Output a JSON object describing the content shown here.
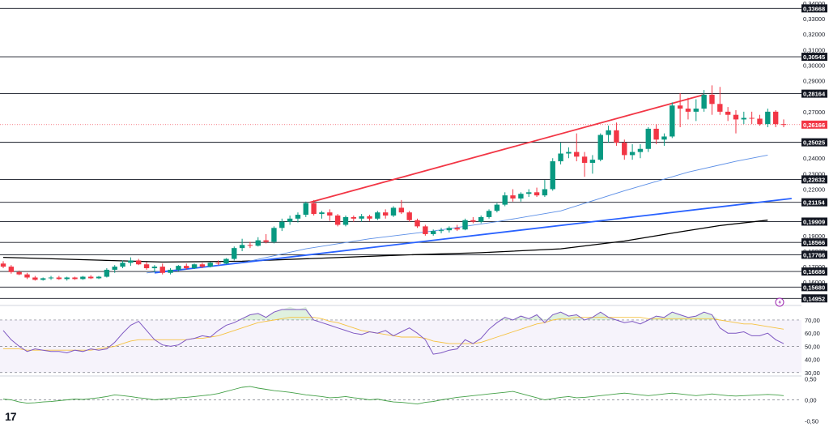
{
  "chart_data": {
    "type": "candlestick",
    "price_axis": {
      "ticks": [
        "0,34000",
        "0,33000",
        "0,32000",
        "0,31000",
        "0,30000",
        "0,29000",
        "0,27000",
        "0,24000",
        "0,23000",
        "0,22000",
        "0,19000",
        "0,18000",
        "0,17000",
        "0,16000"
      ],
      "ylim": [
        0.146,
        0.34
      ]
    },
    "levels": [
      {
        "label": "0,33668",
        "value": 0.33668
      },
      {
        "label": "0,30545",
        "value": 0.30545
      },
      {
        "label": "0,28164",
        "value": 0.28164
      },
      {
        "label": "0,25025",
        "value": 0.25025
      },
      {
        "label": "0,22632",
        "value": 0.22632
      },
      {
        "label": "0,21154",
        "value": 0.21154
      },
      {
        "label": "0,19909",
        "value": 0.19909
      },
      {
        "label": "0,18566",
        "value": 0.18566
      },
      {
        "label": "0,17766",
        "value": 0.17766
      },
      {
        "label": "0,16686",
        "value": 0.16686
      },
      {
        "label": "0,15680",
        "value": 0.1568
      },
      {
        "label": "0,14952",
        "value": 0.14952
      }
    ],
    "current_price": {
      "label": "0,26166",
      "value": 0.26166,
      "color": "#f23645"
    },
    "candles": [
      [
        0.172,
        0.1735,
        0.169,
        0.17
      ],
      [
        0.17,
        0.171,
        0.1655,
        0.1665
      ],
      [
        0.1665,
        0.1675,
        0.1645,
        0.165
      ],
      [
        0.165,
        0.166,
        0.162,
        0.163
      ],
      [
        0.163,
        0.164,
        0.161,
        0.1615
      ],
      [
        0.1615,
        0.163,
        0.161,
        0.1625
      ],
      [
        0.1625,
        0.164,
        0.1615,
        0.163
      ],
      [
        0.163,
        0.164,
        0.1615,
        0.162
      ],
      [
        0.162,
        0.1635,
        0.161,
        0.163
      ],
      [
        0.163,
        0.1635,
        0.1615,
        0.162
      ],
      [
        0.162,
        0.164,
        0.1615,
        0.1635
      ],
      [
        0.1635,
        0.1645,
        0.162,
        0.1625
      ],
      [
        0.1625,
        0.164,
        0.162,
        0.1635
      ],
      [
        0.1635,
        0.169,
        0.163,
        0.168
      ],
      [
        0.168,
        0.171,
        0.166,
        0.17
      ],
      [
        0.17,
        0.174,
        0.169,
        0.1725
      ],
      [
        0.1725,
        0.176,
        0.1705,
        0.174
      ],
      [
        0.174,
        0.175,
        0.171,
        0.1715
      ],
      [
        0.1715,
        0.173,
        0.168,
        0.169
      ],
      [
        0.169,
        0.171,
        0.1665,
        0.17
      ],
      [
        0.17,
        0.172,
        0.165,
        0.166
      ],
      [
        0.166,
        0.169,
        0.165,
        0.168
      ],
      [
        0.168,
        0.171,
        0.167,
        0.1705
      ],
      [
        0.1705,
        0.172,
        0.168,
        0.169
      ],
      [
        0.169,
        0.172,
        0.1685,
        0.1715
      ],
      [
        0.1715,
        0.1725,
        0.169,
        0.17
      ],
      [
        0.17,
        0.173,
        0.1695,
        0.1725
      ],
      [
        0.1725,
        0.174,
        0.171,
        0.172
      ],
      [
        0.172,
        0.1755,
        0.1715,
        0.175
      ],
      [
        0.175,
        0.183,
        0.174,
        0.182
      ],
      [
        0.182,
        0.188,
        0.18,
        0.184
      ],
      [
        0.184,
        0.186,
        0.182,
        0.1835
      ],
      [
        0.1835,
        0.189,
        0.183,
        0.187
      ],
      [
        0.187,
        0.191,
        0.185,
        0.186
      ],
      [
        0.186,
        0.196,
        0.185,
        0.195
      ],
      [
        0.195,
        0.201,
        0.193,
        0.199
      ],
      [
        0.199,
        0.203,
        0.197,
        0.201
      ],
      [
        0.201,
        0.205,
        0.1985,
        0.2035
      ],
      [
        0.2035,
        0.212,
        0.202,
        0.211
      ],
      [
        0.211,
        0.213,
        0.203,
        0.204
      ],
      [
        0.204,
        0.206,
        0.201,
        0.205
      ],
      [
        0.205,
        0.207,
        0.1995,
        0.203
      ],
      [
        0.203,
        0.204,
        0.196,
        0.197
      ],
      [
        0.197,
        0.203,
        0.196,
        0.202
      ],
      [
        0.202,
        0.203,
        0.199,
        0.201
      ],
      [
        0.201,
        0.204,
        0.199,
        0.2025
      ],
      [
        0.2025,
        0.2035,
        0.1995,
        0.201
      ],
      [
        0.201,
        0.206,
        0.2,
        0.205
      ],
      [
        0.205,
        0.207,
        0.201,
        0.203
      ],
      [
        0.203,
        0.209,
        0.202,
        0.208
      ],
      [
        0.208,
        0.213,
        0.204,
        0.205
      ],
      [
        0.205,
        0.206,
        0.199,
        0.2
      ],
      [
        0.2,
        0.201,
        0.195,
        0.196
      ],
      [
        0.196,
        0.197,
        0.19,
        0.191
      ],
      [
        0.191,
        0.194,
        0.19,
        0.193
      ],
      [
        0.193,
        0.195,
        0.1915,
        0.1935
      ],
      [
        0.1935,
        0.196,
        0.192,
        0.195
      ],
      [
        0.195,
        0.197,
        0.193,
        0.194
      ],
      [
        0.194,
        0.201,
        0.1935,
        0.2
      ],
      [
        0.2,
        0.202,
        0.198,
        0.199
      ],
      [
        0.199,
        0.203,
        0.198,
        0.202
      ],
      [
        0.202,
        0.207,
        0.201,
        0.206
      ],
      [
        0.206,
        0.211,
        0.205,
        0.21
      ],
      [
        0.21,
        0.218,
        0.209,
        0.216
      ],
      [
        0.216,
        0.22,
        0.212,
        0.214
      ],
      [
        0.214,
        0.218,
        0.212,
        0.217
      ],
      [
        0.217,
        0.22,
        0.215,
        0.218
      ],
      [
        0.218,
        0.221,
        0.215,
        0.216
      ],
      [
        0.216,
        0.226,
        0.215,
        0.22
      ],
      [
        0.22,
        0.24,
        0.219,
        0.238
      ],
      [
        0.238,
        0.25,
        0.236,
        0.243
      ],
      [
        0.243,
        0.247,
        0.24,
        0.244
      ],
      [
        0.244,
        0.256,
        0.238,
        0.241
      ],
      [
        0.241,
        0.244,
        0.228,
        0.237
      ],
      [
        0.237,
        0.242,
        0.23,
        0.239
      ],
      [
        0.239,
        0.256,
        0.238,
        0.255
      ],
      [
        0.255,
        0.261,
        0.25,
        0.258
      ],
      [
        0.258,
        0.263,
        0.248,
        0.25
      ],
      [
        0.25,
        0.252,
        0.239,
        0.242
      ],
      [
        0.242,
        0.249,
        0.239,
        0.244
      ],
      [
        0.244,
        0.249,
        0.24,
        0.246
      ],
      [
        0.246,
        0.26,
        0.244,
        0.259
      ],
      [
        0.259,
        0.262,
        0.249,
        0.252
      ],
      [
        0.252,
        0.256,
        0.248,
        0.254
      ],
      [
        0.254,
        0.276,
        0.253,
        0.274
      ],
      [
        0.274,
        0.282,
        0.26,
        0.272
      ],
      [
        0.272,
        0.279,
        0.265,
        0.27
      ],
      [
        0.27,
        0.278,
        0.264,
        0.272
      ],
      [
        0.272,
        0.284,
        0.27,
        0.281
      ],
      [
        0.281,
        0.287,
        0.268,
        0.275
      ],
      [
        0.275,
        0.286,
        0.268,
        0.27
      ],
      [
        0.27,
        0.273,
        0.264,
        0.268
      ],
      [
        0.268,
        0.271,
        0.256,
        0.265
      ],
      [
        0.265,
        0.27,
        0.262,
        0.266
      ],
      [
        0.266,
        0.27,
        0.262,
        0.2655
      ],
      [
        0.2655,
        0.268,
        0.261,
        0.262
      ],
      [
        0.262,
        0.272,
        0.26,
        0.27
      ],
      [
        0.27,
        0.271,
        0.26,
        0.262
      ],
      [
        0.262,
        0.265,
        0.26,
        0.2617
      ]
    ],
    "moving_averages": [
      {
        "color": "#000000",
        "points": [
          [
            0,
            0.176
          ],
          [
            10,
            0.1745
          ],
          [
            20,
            0.173
          ],
          [
            30,
            0.1735
          ],
          [
            40,
            0.1755
          ],
          [
            50,
            0.1775
          ],
          [
            60,
            0.179
          ],
          [
            70,
            0.1815
          ],
          [
            78,
            0.1865
          ],
          [
            85,
            0.1925
          ],
          [
            90,
            0.1965
          ],
          [
            96,
            0.2
          ]
        ]
      },
      {
        "color": "#5b8ee6",
        "points": [
          [
            18,
            0.166
          ],
          [
            30,
            0.1725
          ],
          [
            38,
            0.1815
          ],
          [
            46,
            0.188
          ],
          [
            54,
            0.193
          ],
          [
            62,
            0.199
          ],
          [
            70,
            0.206
          ],
          [
            78,
            0.219
          ],
          [
            86,
            0.231
          ],
          [
            92,
            0.238
          ],
          [
            96,
            0.242
          ]
        ]
      }
    ],
    "trendlines": [
      {
        "color": "#f23645",
        "from": [
          38.5,
          0.2115
        ],
        "to": [
          88,
          0.281
        ]
      },
      {
        "color": "#2962ff",
        "from": [
          19,
          0.166
        ],
        "to": [
          99,
          0.214
        ]
      }
    ],
    "rsi": {
      "ticks": [
        "70,00",
        "60,00",
        "50,00",
        "40,00",
        "30,00"
      ],
      "ylim": [
        28,
        78
      ],
      "levels": [
        70,
        50,
        30
      ],
      "values": [
        62,
        55,
        50,
        46,
        48,
        47,
        46,
        46,
        45,
        47,
        46,
        48,
        47,
        48,
        53,
        60,
        66,
        69,
        62,
        55,
        51,
        50,
        51,
        55,
        56,
        58,
        57,
        62,
        66,
        68,
        71,
        74,
        75,
        72,
        76,
        78,
        80,
        78,
        80,
        70,
        68,
        66,
        64,
        62,
        60,
        59,
        61,
        60,
        62,
        58,
        61,
        64,
        60,
        55,
        44,
        45,
        47,
        48,
        55,
        52,
        56,
        63,
        68,
        72,
        70,
        73,
        71,
        74,
        68,
        74,
        76,
        73,
        74,
        70,
        72,
        76,
        72,
        70,
        68,
        69,
        67,
        70,
        73,
        72,
        76,
        74,
        72,
        73,
        76,
        74,
        64,
        60,
        60,
        61,
        58,
        58,
        60,
        55,
        52
      ],
      "signal": [
        48,
        48,
        48,
        47,
        47,
        47,
        47,
        47,
        47,
        47,
        47,
        47,
        48,
        49,
        50,
        52,
        54,
        55,
        55,
        55,
        55,
        55,
        55,
        55,
        56,
        56,
        57,
        58,
        60,
        62,
        64,
        66,
        68,
        69,
        70,
        71,
        72,
        72,
        72,
        72,
        71,
        69,
        68,
        66,
        64,
        62,
        61,
        60,
        59,
        58,
        57,
        57,
        57,
        56,
        54,
        53,
        52,
        52,
        52,
        52,
        53,
        55,
        57,
        59,
        61,
        63,
        65,
        67,
        68,
        70,
        71,
        71,
        72,
        72,
        72,
        72,
        72,
        72,
        72,
        72,
        72,
        71,
        71,
        71,
        71,
        71,
        71,
        71,
        71,
        71,
        70,
        69,
        68,
        67,
        67,
        66,
        65,
        64,
        63
      ]
    },
    "momentum": {
      "ticks": [
        "0,50",
        "0,00",
        "-0,50"
      ],
      "ylim": [
        -0.55,
        0.55
      ],
      "values": [
        0.02,
        0.0,
        -0.05,
        -0.08,
        -0.07,
        -0.05,
        -0.04,
        -0.02,
        0.0,
        0.02,
        0.01,
        0.03,
        0.05,
        0.08,
        0.12,
        0.1,
        0.08,
        0.05,
        0.03,
        0.0,
        0.02,
        0.03,
        0.05,
        0.06,
        0.08,
        0.1,
        0.12,
        0.15,
        0.2,
        0.25,
        0.3,
        0.32,
        0.28,
        0.25,
        0.22,
        0.2,
        0.18,
        0.15,
        0.12,
        0.1,
        0.08,
        0.05,
        0.06,
        0.08,
        0.05,
        0.03,
        0.0,
        0.02,
        -0.02,
        -0.05,
        -0.06,
        -0.08,
        -0.1,
        -0.06,
        -0.04,
        0.0,
        0.03,
        0.06,
        0.08,
        0.1,
        0.12,
        0.14,
        0.16,
        0.18,
        0.2,
        0.15,
        0.1,
        0.05,
        0.0,
        0.03,
        0.06,
        0.08,
        0.05,
        0.06,
        0.08,
        0.1,
        0.12,
        0.14,
        0.16,
        0.14,
        0.12,
        0.1,
        0.12,
        0.14,
        0.16,
        0.14,
        0.12,
        0.1,
        0.12,
        0.14,
        0.12,
        0.1,
        0.09,
        0.1,
        0.11,
        0.12,
        0.13,
        0.12,
        0.1
      ]
    },
    "colors": {
      "up": "#089981",
      "down": "#f23645",
      "rsi": "#7e57c2",
      "rsi_signal": "#f5c242",
      "momentum": "#43a047"
    }
  },
  "branding": {
    "logo_text": "17"
  }
}
